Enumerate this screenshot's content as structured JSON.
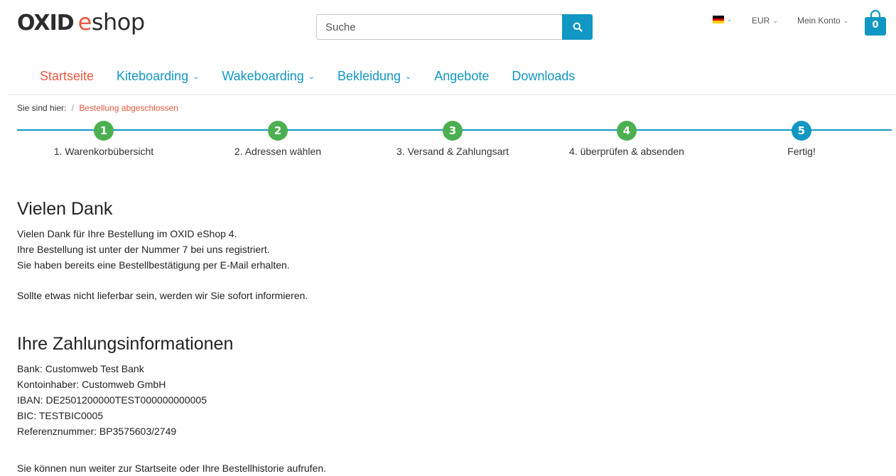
{
  "header": {
    "logo_oxid": "oxid",
    "logo_eshop_e": "e",
    "logo_eshop_rest": "shop",
    "search_placeholder": "Suche",
    "search_icon": "search-icon",
    "language_flag": "de-flag",
    "currency": "EUR",
    "account": "Mein Konto",
    "cart_count": "0",
    "flag_colors": [
      "#000000",
      "#dd0000",
      "#ffce00"
    ]
  },
  "nav": {
    "items": [
      {
        "label": "Startseite",
        "dropdown": false,
        "active": true
      },
      {
        "label": "Kiteboarding",
        "dropdown": true,
        "active": false
      },
      {
        "label": "Wakeboarding",
        "dropdown": true,
        "active": false
      },
      {
        "label": "Bekleidung",
        "dropdown": true,
        "active": false
      },
      {
        "label": "Angebote",
        "dropdown": false,
        "active": false
      },
      {
        "label": "Downloads",
        "dropdown": false,
        "active": false
      }
    ]
  },
  "breadcrumb": {
    "prefix": "Sie sind hier:",
    "separator": "/",
    "current": "Bestellung abgeschlossen"
  },
  "steps": {
    "items": [
      {
        "number": "1",
        "label": "1. Warenkorbübersicht",
        "status": "done"
      },
      {
        "number": "2",
        "label": "2. Adressen wählen",
        "status": "done"
      },
      {
        "number": "3",
        "label": "3. Versand & Zahlungsart",
        "status": "done"
      },
      {
        "number": "4",
        "label": "4. überprüfen & absenden",
        "status": "done"
      },
      {
        "number": "5",
        "label": "Fertig!",
        "status": "active"
      }
    ],
    "colors": {
      "done": "#4caf50",
      "active": "#1197c3",
      "line": "#1197c3"
    }
  },
  "thanks": {
    "title": "Vielen Dank",
    "line1": "Vielen Dank für Ihre Bestellung im OXID eShop 4.",
    "line2": "Ihre Bestellung ist unter der Nummer 7 bei uns registriert.",
    "line3": "Sie haben bereits eine Bestellbestätigung per E-Mail erhalten.",
    "line4": "Sollte etwas nicht lieferbar sein, werden wir Sie sofort informieren."
  },
  "payment": {
    "title": "Ihre Zahlungsinformationen",
    "bank": "Bank: Customweb Test Bank",
    "holder": "Kontoinhaber: Customweb GmbH",
    "iban": "IBAN: DE2501200000TEST000000000005",
    "bic": "BIC: TESTBIC0005",
    "reference": "Referenznummer: BP3575603/2749"
  },
  "footer_note": "Sie können nun weiter zur Startseite oder Ihre Bestellhistorie aufrufen.",
  "accent": "#1197c3",
  "highlight": "#e9573f"
}
